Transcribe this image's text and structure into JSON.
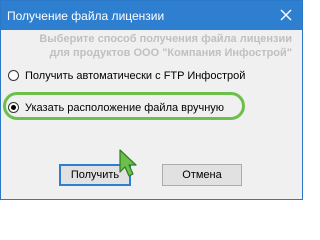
{
  "window": {
    "title": "Получение файла лицензии"
  },
  "description": {
    "line1": "Выберите способ получения файла лицензии",
    "line2": "для продуктов ООО \"Компания Инфострой\""
  },
  "options": [
    {
      "label": "Получить автоматически с FTP Инфострой",
      "checked": false
    },
    {
      "label": "Указать расположение файла вручную",
      "checked": true
    }
  ],
  "buttons": {
    "get_label": "Получить",
    "cancel_label": "Отмена"
  },
  "colors": {
    "titlebar": "#2f7fd0",
    "highlight": "#6cbf4a",
    "cursor": "#6cbf4a"
  }
}
